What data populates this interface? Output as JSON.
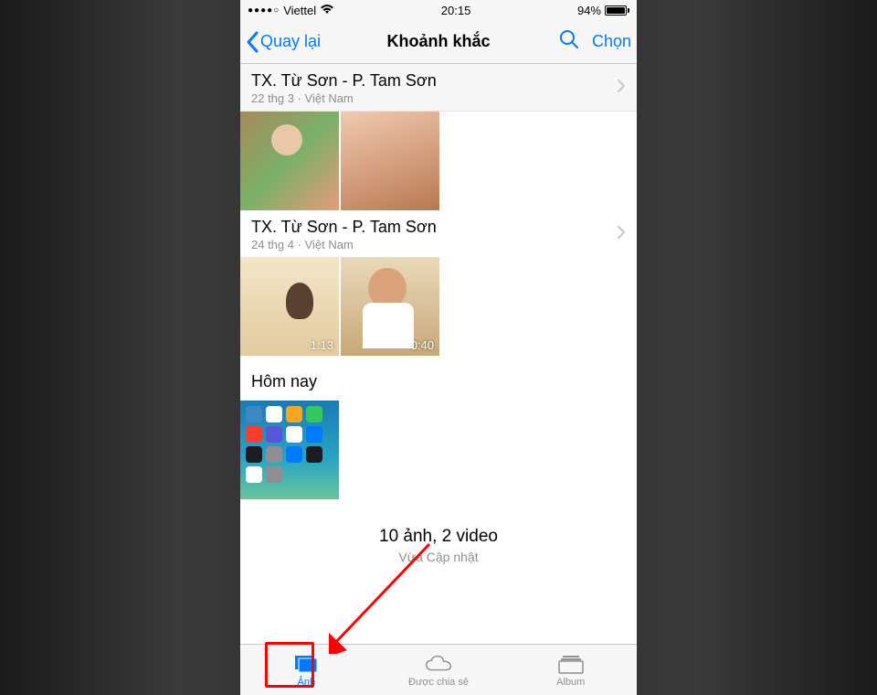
{
  "status": {
    "signal_dots": "●●●●○",
    "carrier": "Viettel",
    "time": "20:15",
    "battery_pct": "94%"
  },
  "nav": {
    "back_label": "Quay lại",
    "title": "Khoảnh khắc",
    "select_label": "Chọn"
  },
  "sections": [
    {
      "title": "TX. Từ Sơn - P. Tam Sơn",
      "subtitle": "22 thg 3 · Việt Nam",
      "thumbs": [
        {
          "duration": ""
        },
        {
          "duration": ""
        }
      ]
    },
    {
      "title": "TX. Từ Sơn - P. Tam Sơn",
      "subtitle": "24 thg 4 · Việt Nam",
      "thumbs": [
        {
          "duration": "1:13"
        },
        {
          "duration": "0:40"
        }
      ]
    }
  ],
  "today": {
    "title": "Hôm nay"
  },
  "summary": {
    "main": "10 ảnh, 2 video",
    "sub": "Vừa Cập nhật"
  },
  "tabs": {
    "photos": "Ảnh",
    "shared": "Được chia sẻ",
    "albums": "Album"
  }
}
